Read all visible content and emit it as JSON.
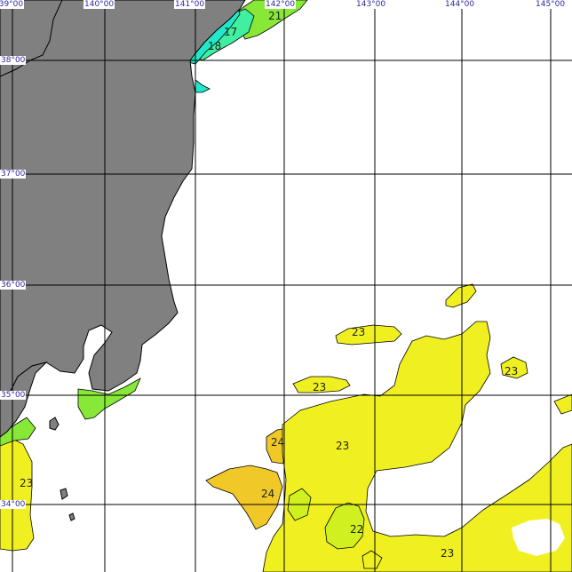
{
  "map": {
    "longitude_labels": [
      "139°00",
      "140°00",
      "141°00",
      "142°00",
      "143°00",
      "144°00",
      "145°00"
    ],
    "latitude_labels": [
      "38°00",
      "37°00",
      "36°00",
      "35°00",
      "34°00"
    ],
    "contour_labels": [
      "21",
      "17",
      "18",
      "23",
      "23",
      "23",
      "24",
      "23",
      "24",
      "22",
      "23",
      "23"
    ]
  },
  "colors": {
    "land": "#808080",
    "sst_17": "#20e8c8",
    "sst_18": "#40f0a0",
    "sst_21": "#88e838",
    "sst_22": "#d0f020",
    "sst_23": "#f0f020",
    "sst_24": "#f0c828",
    "grid": "#000000"
  }
}
